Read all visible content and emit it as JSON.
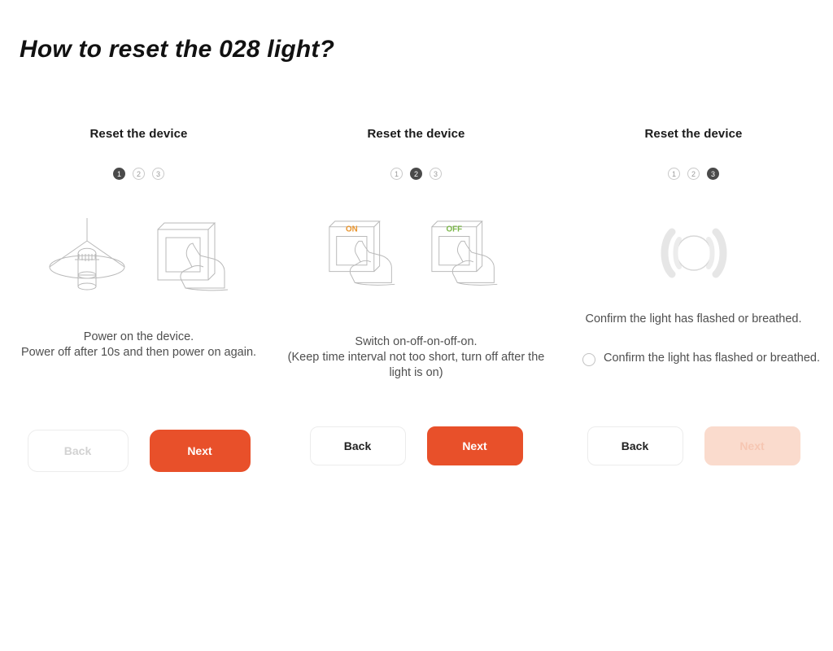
{
  "page": {
    "title": "How to reset the 028 light?"
  },
  "colors": {
    "accent": "#e8502a",
    "accent_disabled": "#fadbcd",
    "step_active": "#4a4a4a",
    "switch_on_label": "#e8922a",
    "switch_off_label": "#7ab648",
    "illustration_line": "#b9b9b9"
  },
  "panels": [
    {
      "title": "Reset the device",
      "steps": [
        "1",
        "2",
        "3"
      ],
      "active_step": 1,
      "illustration": [
        "pendant-lamp-icon",
        "hand-press-switch-icon"
      ],
      "caption": "Power on the device.\nPower off after 10s and then power on again.",
      "buttons": {
        "back_label": "Back",
        "back_disabled": true,
        "next_label": "Next",
        "next_disabled": false
      }
    },
    {
      "title": "Reset the device",
      "steps": [
        "1",
        "2",
        "3"
      ],
      "active_step": 2,
      "illustration": [
        "hand-press-switch-on-icon",
        "hand-press-switch-off-icon"
      ],
      "switch_labels": {
        "on": "ON",
        "off": "OFF"
      },
      "caption": "Switch on-off-on-off-on.\n(Keep time interval not too short, turn off after the light is on)",
      "buttons": {
        "back_label": "Back",
        "back_disabled": false,
        "next_label": "Next",
        "next_disabled": false
      }
    },
    {
      "title": "Reset the device",
      "steps": [
        "1",
        "2",
        "3"
      ],
      "active_step": 3,
      "illustration": [
        "blinking-light-icon"
      ],
      "caption": "Confirm the light has flashed or breathed.",
      "confirm": {
        "label": "Confirm the light has flashed or breathed.",
        "checked": false
      },
      "buttons": {
        "back_label": "Back",
        "back_disabled": false,
        "next_label": "Next",
        "next_disabled": true
      }
    }
  ]
}
